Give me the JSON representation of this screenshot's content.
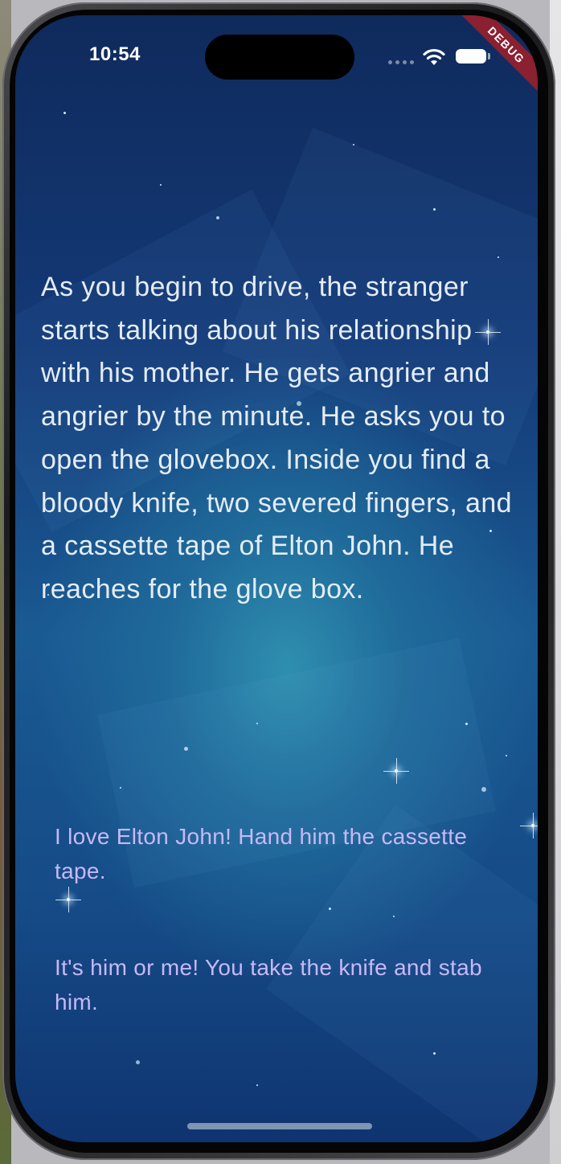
{
  "status_bar": {
    "time": "10:54",
    "debug_banner": "DEBUG"
  },
  "story": {
    "text": "As you begin to drive, the stranger starts talking about his relationship with his mother. He gets angrier and angrier by the minute. He asks you to open the glovebox. Inside you find a bloody knife, two severed fingers, and a cassette tape of Elton John. He reaches for the glove box."
  },
  "choices": [
    {
      "label": "I love Elton John! Hand him the cassette tape."
    },
    {
      "label": "It's him or me! You take the knife and stab him."
    }
  ],
  "colors": {
    "background_top": "#0f2a5c",
    "background_glow": "#2f8fb0",
    "story_text": "#e4ecf6",
    "choice_text": "#c8b8f6",
    "debug_banner": "#a01e28"
  },
  "icons": [
    "wifi-icon",
    "battery-icon",
    "cellular-signal-icon"
  ]
}
